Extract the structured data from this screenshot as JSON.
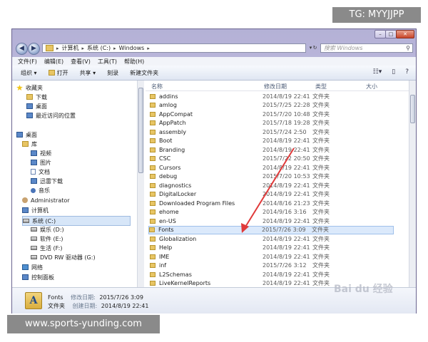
{
  "address": {
    "crumbs": [
      "计算机",
      "系统 (C:)",
      "Windows"
    ],
    "search_placeholder": "搜索 Windows"
  },
  "menu": [
    "文件(F)",
    "编辑(E)",
    "查看(V)",
    "工具(T)",
    "帮助(H)"
  ],
  "toolbar": [
    "组织 ▾",
    "打开",
    "共享 ▾",
    "刻录",
    "新建文件夹"
  ],
  "nav": {
    "favorites": "收藏夹",
    "fav_items": [
      "下载",
      "桌面",
      "最近访问的位置"
    ],
    "desktop": "桌面",
    "library": "库",
    "lib_items": [
      "视频",
      "图片",
      "文档",
      "迅雷下载",
      "音乐"
    ],
    "administrator": "Administrator",
    "computer": "计算机",
    "drives": [
      "系统 (C:)",
      "娱乐 (D:)",
      "软件 (E:)",
      "生活 (F:)",
      "DVD RW 驱动器 (G:)"
    ],
    "network": "网络",
    "control_panel": "控制面板"
  },
  "columns": {
    "name": "名称",
    "date": "修改日期",
    "type": "类型",
    "size": "大小"
  },
  "files": [
    {
      "name": "addins",
      "date": "2014/8/19 22:41",
      "type": "文件夹"
    },
    {
      "name": "amlog",
      "date": "2015/7/25 22:28",
      "type": "文件夹"
    },
    {
      "name": "AppCompat",
      "date": "2015/7/20 10:48",
      "type": "文件夹"
    },
    {
      "name": "AppPatch",
      "date": "2015/7/18 19:28",
      "type": "文件夹"
    },
    {
      "name": "assembly",
      "date": "2015/7/24 2:50",
      "type": "文件夹"
    },
    {
      "name": "Boot",
      "date": "2014/8/19 22:41",
      "type": "文件夹"
    },
    {
      "name": "Branding",
      "date": "2014/8/19 22:41",
      "type": "文件夹"
    },
    {
      "name": "CSC",
      "date": "2015/7/22 20:50",
      "type": "文件夹"
    },
    {
      "name": "Cursors",
      "date": "2014/8/19 22:41",
      "type": "文件夹"
    },
    {
      "name": "debug",
      "date": "2015/7/20 10:53",
      "type": "文件夹"
    },
    {
      "name": "diagnostics",
      "date": "2014/8/19 22:41",
      "type": "文件夹"
    },
    {
      "name": "DigitalLocker",
      "date": "2014/8/19 22:41",
      "type": "文件夹"
    },
    {
      "name": "Downloaded Program Files",
      "date": "2014/8/16 21:23",
      "type": "文件夹"
    },
    {
      "name": "ehome",
      "date": "2014/9/16 3:16",
      "type": "文件夹"
    },
    {
      "name": "en-US",
      "date": "2014/8/19 22:41",
      "type": "文件夹"
    },
    {
      "name": "Fonts",
      "date": "2015/7/26 3:09",
      "type": "文件夹"
    },
    {
      "name": "Globalization",
      "date": "2014/8/19 22:41",
      "type": "文件夹"
    },
    {
      "name": "Help",
      "date": "2014/8/19 22:41",
      "type": "文件夹"
    },
    {
      "name": "IME",
      "date": "2014/8/19 22:41",
      "type": "文件夹"
    },
    {
      "name": "inf",
      "date": "2015/7/26 3:12",
      "type": "文件夹"
    },
    {
      "name": "L2Schemas",
      "date": "2014/8/19 22:41",
      "type": "文件夹"
    },
    {
      "name": "LiveKernelReports",
      "date": "2014/8/19 22:41",
      "type": "文件夹"
    }
  ],
  "selected_index": 15,
  "details": {
    "name": "Fonts",
    "modified_label": "修改日期:",
    "modified": "2015/7/26 3:09",
    "type_label": "文件夹",
    "created_label": "创建日期:",
    "created": "2014/8/19 22:41"
  },
  "overlay": {
    "tg": "TG: MYYJJPP",
    "url": "www.sports-yunding.com",
    "baidu": "Bai du 经验"
  },
  "colors": {
    "arrow": "#e03a3a",
    "selection": "#dbe9fb"
  }
}
